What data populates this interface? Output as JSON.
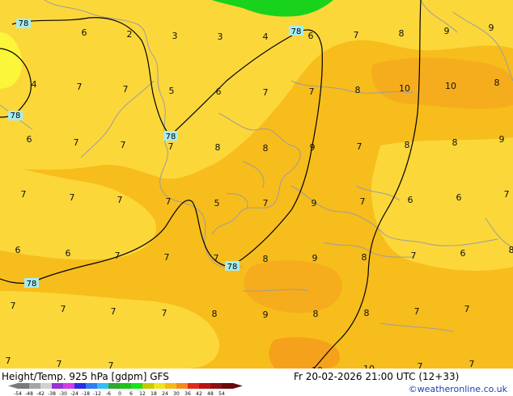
{
  "map": {
    "title": "Height/Temp. 925 hPa [gdpm] GFS",
    "valid_time": "Fr 20-02-2026 21:00 UTC (12+33)",
    "credit": "©weatheronline.co.uk",
    "colors": {
      "background": "#f7bd1c",
      "light_yellow": "#fcd73a",
      "bright_yellow": "#fbf63a",
      "orange": "#f4a81e",
      "green": "#19d21c",
      "coast": "#9d9d9d",
      "contour": "#000000",
      "contour_label_bg": "#a8ecf0"
    },
    "contour_labels": [
      "78",
      "78",
      "78",
      "78",
      "78",
      "78"
    ],
    "temperature_labels": [
      "6",
      "2",
      "3",
      "3",
      "4",
      "6",
      "7",
      "8",
      "9",
      "9",
      "4",
      "7",
      "7",
      "5",
      "6",
      "7",
      "7",
      "8",
      "10",
      "10",
      "8",
      "6",
      "7",
      "7",
      "7",
      "8",
      "8",
      "9",
      "7",
      "8",
      "8",
      "9",
      "7",
      "7",
      "7",
      "7",
      "5",
      "7",
      "9",
      "7",
      "6",
      "6",
      "7",
      "6",
      "6",
      "7",
      "7",
      "7",
      "8",
      "9",
      "8",
      "7",
      "6",
      "8",
      "7",
      "7",
      "7",
      "7",
      "8",
      "9",
      "8",
      "8",
      "7",
      "7",
      "7",
      "7",
      "7",
      "10",
      "10",
      "7",
      "7"
    ],
    "scale": {
      "tick_labels": [
        "-54",
        "-48",
        "-42",
        "-38",
        "-30",
        "-24",
        "-18",
        "-12",
        "-6",
        "0",
        "6",
        "12",
        "18",
        "24",
        "30",
        "36",
        "42",
        "48",
        "54"
      ],
      "colors": [
        "#7a7a7a",
        "#a5a5a5",
        "#d0d0d0",
        "#9c2fd6",
        "#d33de8",
        "#2d2de0",
        "#2f7df2",
        "#33bff5",
        "#2ea82e",
        "#1ec21e",
        "#1ce11c",
        "#c8c800",
        "#f0e41e",
        "#f5b81c",
        "#f58a1c",
        "#e02a1a",
        "#b81414",
        "#8e1010",
        "#6a0a0a"
      ]
    }
  }
}
